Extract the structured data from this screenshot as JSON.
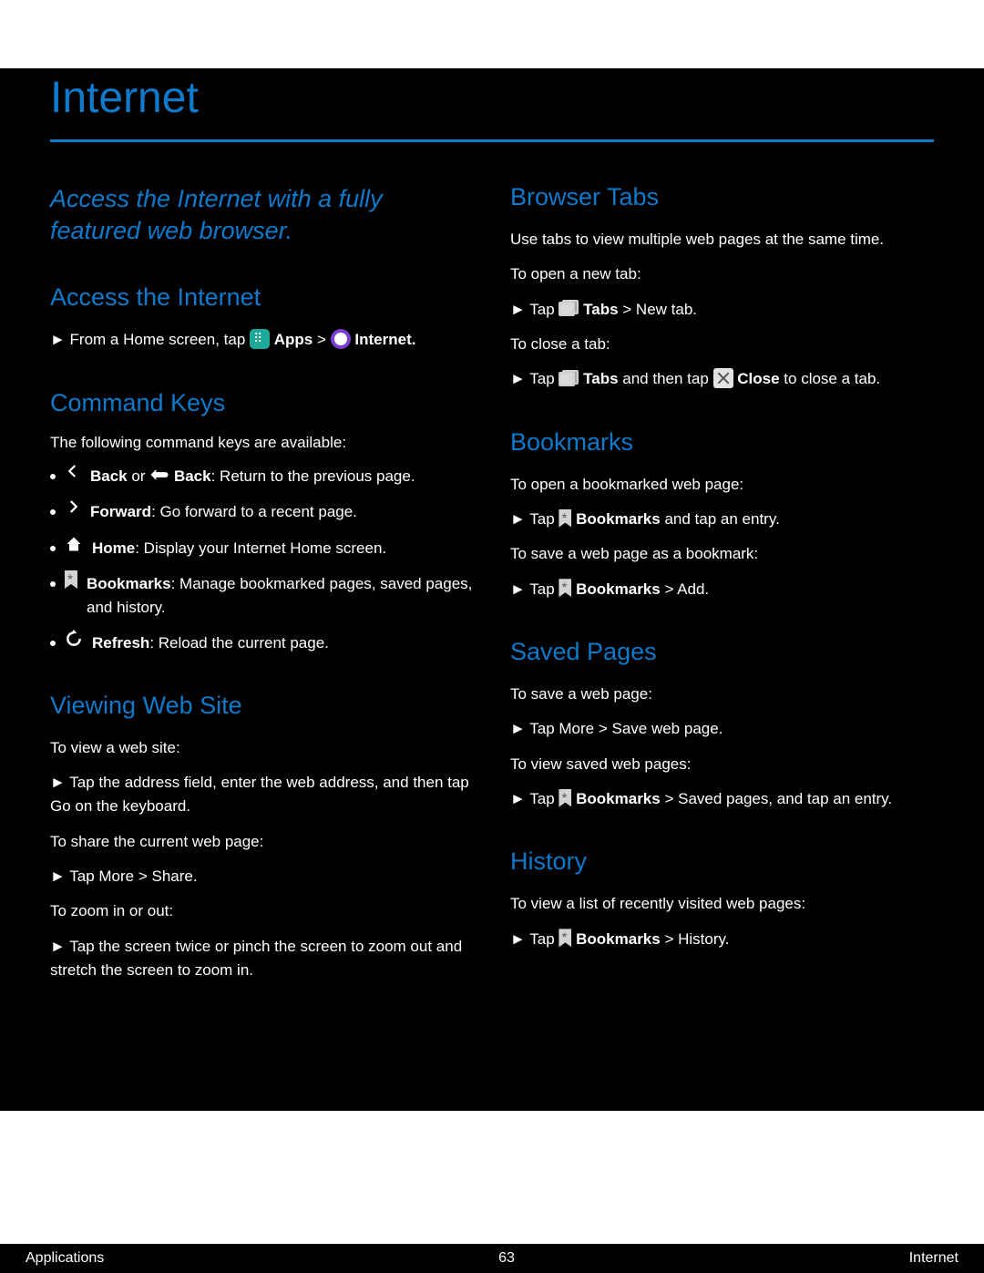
{
  "page": {
    "title": "Internet",
    "intro": "Access the Internet with a fully featured web browser."
  },
  "left": {
    "access": {
      "heading": "Access the Internet",
      "pre": "► From a Home screen, tap",
      "apps_label": "Apps",
      "then": "> ",
      "internet_label": "Internet."
    },
    "command_keys": {
      "heading": "Command Keys",
      "intro": "The following command keys are available:",
      "items": [
        {
          "icon": "back-arrow-icon",
          "label": "Back",
          "or_icon": "device-back-icon",
          "or_label": "Back",
          "desc": ": Return to the previous page."
        },
        {
          "icon": "forward-arrow-icon",
          "label": "Forward",
          "desc": ": Go forward to a recent page."
        },
        {
          "icon": "home-icon",
          "label": "Home",
          "desc": ": Display your Internet Home screen."
        },
        {
          "icon": "bookmark-icon",
          "label": "Bookmarks",
          "desc": ": Manage bookmarked pages, saved pages, and history."
        },
        {
          "icon": "refresh-icon",
          "label": "Refresh",
          "desc": ": Reload the current page."
        }
      ]
    },
    "viewing": {
      "heading": "Viewing Web Site",
      "lines": [
        "To view a web site:",
        "► Tap the address field, enter the web address, and then tap Go on the keyboard.",
        "To share the current web page:",
        "► Tap More > Share.",
        "To zoom in or out:",
        "► Tap the screen twice or pinch the screen to zoom out and stretch the screen to zoom in."
      ]
    }
  },
  "right": {
    "tabs": {
      "heading": "Browser Tabs",
      "intro": "Use tabs to view multiple web pages at the same time.",
      "open_intro": "To open a new tab:",
      "open_step_pre": "► Tap",
      "open_step_label": "Tabs",
      "open_step_post": " > New tab.",
      "close_intro": "To close a tab:",
      "close_step_pre": "► Tap",
      "close_step_label": "Tabs",
      "close_step_mid": " and then tap",
      "close_step_close_label": "Close",
      "close_step_post": " to close a tab."
    },
    "bookmarks": {
      "heading": "Bookmarks",
      "open_intro": "To open a bookmarked web page:",
      "open_step_pre": "► Tap",
      "open_step_label": "Bookmarks",
      "open_step_post": " and tap an entry.",
      "save_intro": "To save a web page as a bookmark:",
      "save_step_pre": "► Tap",
      "save_step_label": "Bookmarks",
      "save_step_post": " > Add."
    },
    "saved": {
      "heading": "Saved Pages",
      "intro": "To save a web page:",
      "save_step": "► Tap More > Save web page.",
      "view_intro": "To view saved web pages:",
      "view_step_pre": "► Tap",
      "view_step_label": "Bookmarks",
      "view_step_post": " > Saved pages, and tap an entry."
    },
    "history": {
      "heading": "History",
      "intro": "To view a list of recently visited web pages:",
      "step_pre": "► Tap",
      "step_label": "Bookmarks",
      "step_post": " > History."
    }
  },
  "footer": {
    "left": "Applications",
    "center": "63",
    "right": "Internet"
  }
}
